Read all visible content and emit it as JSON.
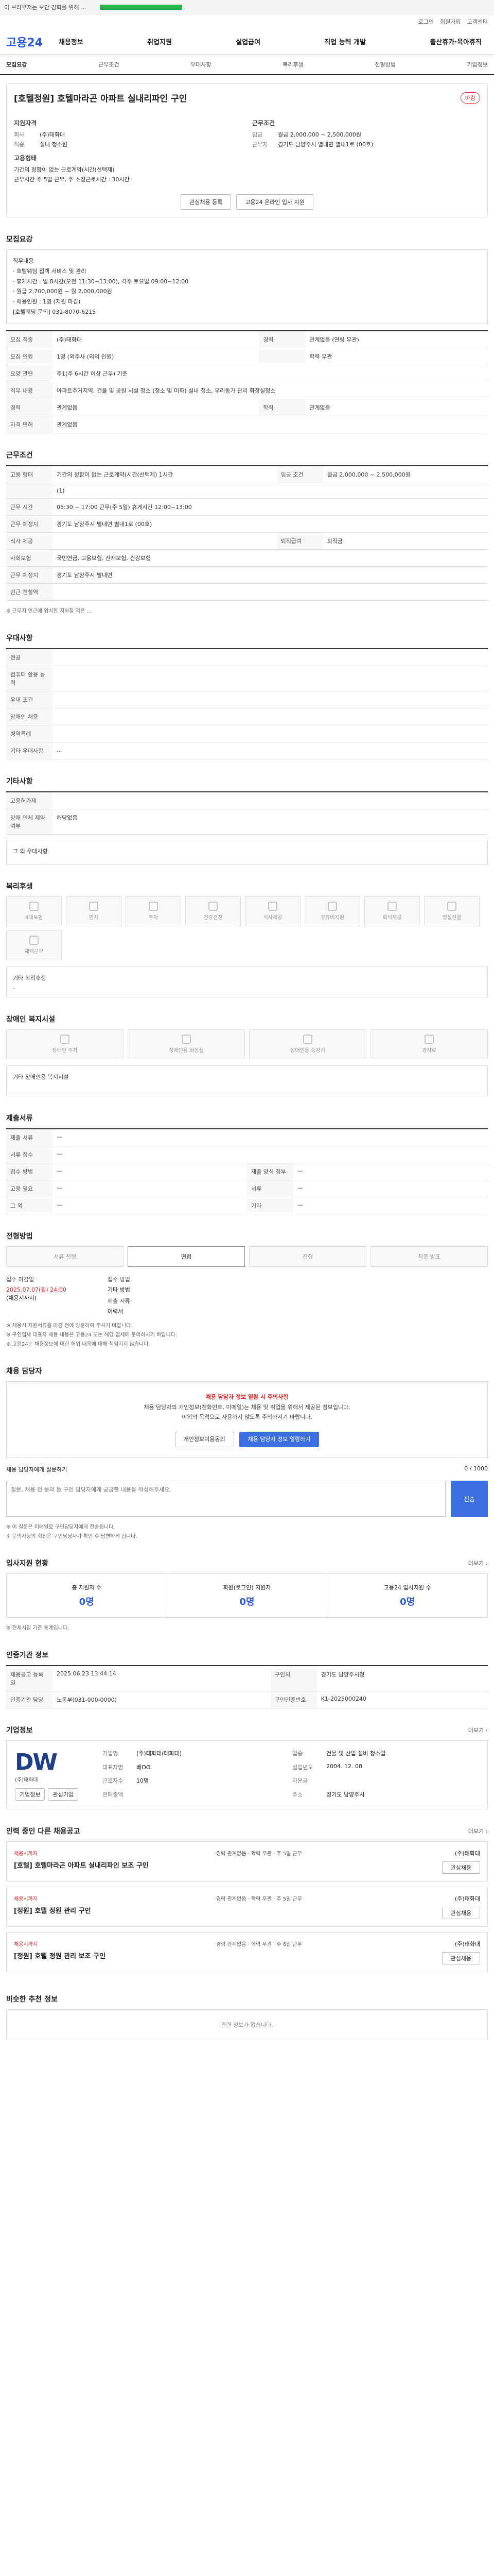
{
  "top": {
    "title": "이 브라우저는 보안 강화를 위해 …",
    "caption": "",
    "download": "완료"
  },
  "util": [
    "로그인",
    "회원가입",
    "고객센터"
  ],
  "logo": "고용24",
  "gnb": [
    "채용정보",
    "취업지원",
    "실업급여",
    "직업 능력 개발",
    "출산휴가·육아휴직"
  ],
  "subnav": [
    "모집요강",
    "근무조건",
    "우대사항",
    "복리후생",
    "전형방법",
    "기업정보"
  ],
  "job": {
    "title": "[호텔정원] 호텔마라곤 아파트 실내리파인 구인",
    "status": "마감",
    "company_label": "회사",
    "company": "(주)태화대",
    "occupation_label": "직종",
    "occupation": "실내 청소원",
    "salary_label": "임금",
    "salary": "월급 2,000,000 ~ 2,500,000원",
    "location_label": "근무지",
    "location": "경기도 남양주시 별내면 별내1로 (00호)",
    "summary_h1": "지원자격",
    "summary_h2": "근무조건",
    "summary_h3": "고용형태",
    "summary_h4": "근무시간",
    "employ_type": "기간의 정함이 없는 근로계약(시간(선택제)",
    "work_time": "주 5일 근무, 주 소정근로시간 : 30시간"
  },
  "actions": {
    "apply": "관심채용 등록",
    "share": "고용24 온라인 입사 지원"
  },
  "recruit": {
    "heading": "모집요강",
    "desc": [
      "직무내용",
      "· 호텔웨딩 접객 서비스 및 관리",
      "· 휴게시간 : 일 8시간(오전 11:30~13:00), 격주 토요일 09:00~12:00",
      "· 월급 2,700,000원 ~ 월 2,000,000원",
      "· 채용인원 : 1명 (지원 마감)",
      "[호텔웨딩 문의] 031-8070-6215"
    ]
  },
  "recruit_table": {
    "rows": [
      [
        "모집 직종",
        "(주)태화대",
        "경력",
        "관계없음 (연령 무관)"
      ],
      [
        "모집 인원",
        "1명 (외주사 (외의 인원)",
        "",
        "학력 무관"
      ],
      [
        "요양 관련",
        "주1(주 6시간 이상 근무) 기준"
      ],
      [
        "직무 내용",
        "아파트주거지역, 건물 및 공원 시설 청소 (청소 및 미화) 실내 청소, 우리동가 관리 화장실청소"
      ],
      [
        "경력",
        "관계없음",
        "학력",
        "관계없음"
      ],
      [
        "자격 면허",
        "관계없음"
      ]
    ]
  },
  "cond": {
    "heading": "근무조건",
    "rows": [
      [
        "고용 형태",
        "기간의 정함이 없는 근로계약(시간(선택제) 1시간",
        "임금 조건",
        "월급 2,000,000 ~ 2,500,000원"
      ],
      [
        "",
        "(1)",
        "",
        ""
      ],
      [
        "근무 시간",
        "08:30 ~ 17:00 근무(주 5일) 휴게시간 12:00~13:00"
      ],
      [
        "근무 예정지",
        "경기도 남양주시 별내면 별내1로 (00호)",
        "",
        ""
      ],
      [
        "식사 제공",
        "",
        "퇴직급여",
        "퇴직금"
      ],
      [
        "사회보험",
        "국민연금, 고용보험, 산재보험, 건강보험",
        "",
        ""
      ],
      [
        "근무 예정지",
        "경기도 남양주시 별내면",
        "",
        ""
      ],
      [
        "인근 전철역",
        "",
        ""
      ]
    ],
    "note": "※ 근무지 인근에 위치한 지하철 역은 ..."
  },
  "pref": {
    "heading": "우대사항",
    "rows": [
      [
        "전공",
        ""
      ],
      [
        "컴퓨터 활용 능력",
        ""
      ],
      [
        "우대 조건",
        ""
      ],
      [
        "장애인 채용",
        ""
      ],
      [
        "병역특례",
        ""
      ],
      [
        "기타 우대사항",
        "..."
      ]
    ]
  },
  "etc": {
    "heading": "기타사항",
    "rows": [
      [
        "고용허가제",
        ""
      ],
      [
        "장애 인체 제약 여부",
        "해당없음"
      ]
    ]
  },
  "extra": {
    "label": "그 외 우대사항",
    "value": ""
  },
  "benefit": {
    "heading": "복리후생",
    "icons": [
      "4대보험",
      "연차",
      "주차",
      "건강검진",
      "식사제공",
      "유류비지원",
      "회식제공",
      "명절선물",
      "재택근무"
    ],
    "etc_label": "기타 복리후생",
    "etc_value": "-"
  },
  "disability": {
    "heading": "장애인 복지시설",
    "icons": [
      "장애인 주차",
      "장애인용 화장실",
      "장애인용 승강기",
      "경사로"
    ],
    "etc_label": "기타 장애인용 복지시설",
    "etc_value": ""
  },
  "docs": {
    "heading": "제출서류",
    "rows": [
      [
        "제출 서류",
        "—",
        "",
        ""
      ],
      [
        "서류 접수",
        "—",
        "",
        ""
      ],
      [
        "접수 방법",
        "—",
        "제출 양식 첨부",
        "—"
      ],
      [
        "고용 필요",
        "—",
        "서류",
        "—"
      ],
      [
        "그 외",
        "—",
        "기타",
        "—"
      ]
    ]
  },
  "process": {
    "heading": "전형방법",
    "steps": [
      "서류 전형",
      "면접",
      "전형",
      "최종 발표"
    ],
    "period_label": "접수 마감일",
    "period_value": "2025.07.07(월) 24:00",
    "period_note": "(채용시까지)",
    "method_label": "접수 방법",
    "method_value": "기타 방법",
    "apply_label": "제출 서류",
    "apply_value": "이력서",
    "notes": [
      "※ 채용시 지원서류를 마감 전에 방문하여 주시기 바랍니다.",
      "※ 구인업체 대표자 채용 내용은 고용24 또는 해당 업체에 문의하시기 바랍니다.",
      "※ 고용24는 채용정보에 대한 허위 내용에 대해 책임지지 않습니다."
    ]
  },
  "contact": {
    "heading": "채용 담당자",
    "alert_title": "채용 담당자 정보 열람 시 주의사항",
    "alert_lines": [
      "채용 담당자의 개인정보(전화번호, 이메일)는 채용 및 취업을 위해서 제공된 정보입니다.",
      "이외의 목적으로 사용하지 않도록 주의하시기 바랍니다."
    ],
    "btn1": "개인정보이용동의",
    "btn2": "채용 담당자 정보 열람하기",
    "ask_label": "채용 담당자에게 질문하기",
    "ask_placeholder": "질문, 채용 전 문의 등 구인 담당자에게 궁금한 내용을 작성해주세요.",
    "ask_btn": "전송",
    "ask_count": "0 / 1000",
    "ask_notes": [
      "※ 이 질문은 이메일로 구인담당자에게 전송됩니다.",
      "※ 문의사항의 회신은 구인담당자가 확인 후 답변하게 됩니다."
    ]
  },
  "stats": {
    "heading": "입사지원 현황",
    "more": "더보기 ›",
    "items": [
      {
        "label": "총 지원자 수",
        "value": "0명"
      },
      {
        "label": "회원(로그인) 지원자",
        "value": "0명"
      },
      {
        "label": "고용24 입사지원 수",
        "value": "0명"
      }
    ],
    "note": "※ 현재시점 기준 통계입니다."
  },
  "info": {
    "heading": "인증기관 정보",
    "rows": [
      [
        "채용공고 등록일",
        "2025.06.23 13:44:14",
        "구인처",
        "경기도 남양주시청"
      ],
      [
        "인증기관 담당",
        "노동부(031-000-0000)",
        "구인인증번호",
        "K1-2025000240"
      ]
    ]
  },
  "company": {
    "heading": "기업정보",
    "more": "더보기 ›",
    "logo_mark": "DW",
    "logo_sub": "(주)태화대",
    "rows": [
      [
        "기업명",
        "(주)태화대(태화대)",
        "업종",
        "건물 및 산업 설비 청소업"
      ],
      [
        "대표자명",
        "배OO",
        "설립년도",
        "2004. 12. 08"
      ],
      [
        "근로자수",
        "10명",
        "자본금",
        ""
      ],
      [
        "연매출액",
        "",
        "주소",
        "경기도 남양주시"
      ]
    ],
    "btn1": "기업정보",
    "btn2": "관심기업"
  },
  "others": {
    "heading": "인력 중인 다른 채용공고",
    "more": "더보기 ›",
    "jobs": [
      {
        "tag": "채용시까지",
        "name": "[호텔] 호텔마라곤 아파트 실내리파인 보조 구인",
        "meta": "경력 관계없음 · 학력 무관 · 주 5일 근무",
        "company": "(주)태화대",
        "btn": "관심채용"
      },
      {
        "tag": "채용시까지",
        "name": "[정원] 호텔 정원 관리 구인",
        "meta": "경력 관계없음 · 학력 무관 · 주 5일 근무",
        "company": "(주)태화대",
        "btn": "관심채용"
      },
      {
        "tag": "채용시까지",
        "name": "[정원] 호텔 정원 관리 보조 구인",
        "meta": "경력 관계없음 · 학력 무관 · 주 6일 근무",
        "company": "(주)태화대",
        "btn": "관심채용"
      }
    ]
  },
  "similar": {
    "heading": "비슷한 추천 정보",
    "empty": "관련 정보가 없습니다."
  }
}
